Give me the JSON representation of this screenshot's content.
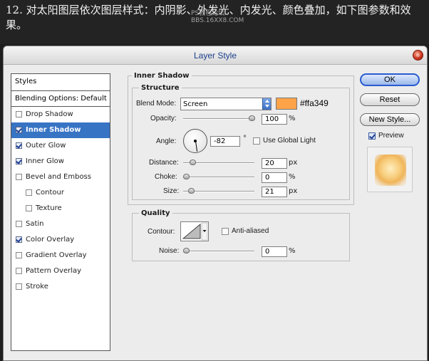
{
  "banner": {
    "text": "12. 对太阳图层依次图层样式：内阴影、外发光、内发光、颜色叠加，如下图参数和效果。",
    "watermark_line1": "PS教程论坛",
    "watermark_line2": "BBS.16XX8.COM"
  },
  "dialog": {
    "title": "Layer Style"
  },
  "styles_panel": {
    "header": "Styles",
    "blending_options": "Blending Options: Default",
    "items": [
      {
        "label": "Drop Shadow",
        "checked": false,
        "indent": 0,
        "selected": false
      },
      {
        "label": "Inner Shadow",
        "checked": true,
        "indent": 0,
        "selected": true
      },
      {
        "label": "Outer Glow",
        "checked": true,
        "indent": 0,
        "selected": false
      },
      {
        "label": "Inner Glow",
        "checked": true,
        "indent": 0,
        "selected": false
      },
      {
        "label": "Bevel and Emboss",
        "checked": false,
        "indent": 0,
        "selected": false
      },
      {
        "label": "Contour",
        "checked": false,
        "indent": 1,
        "selected": false
      },
      {
        "label": "Texture",
        "checked": false,
        "indent": 1,
        "selected": false
      },
      {
        "label": "Satin",
        "checked": false,
        "indent": 0,
        "selected": false
      },
      {
        "label": "Color Overlay",
        "checked": true,
        "indent": 0,
        "selected": false
      },
      {
        "label": "Gradient Overlay",
        "checked": false,
        "indent": 0,
        "selected": false
      },
      {
        "label": "Pattern Overlay",
        "checked": false,
        "indent": 0,
        "selected": false
      },
      {
        "label": "Stroke",
        "checked": false,
        "indent": 0,
        "selected": false
      }
    ]
  },
  "inner_shadow": {
    "section_title": "Inner Shadow",
    "structure_title": "Structure",
    "blend_mode_label": "Blend Mode:",
    "blend_mode_value": "Screen",
    "color_hex": "#ffa349",
    "color_swatch": "#ffa349",
    "opacity_label": "Opacity:",
    "opacity_value": "100",
    "opacity_unit": "%",
    "opacity_level": 1.0,
    "angle_label": "Angle:",
    "angle_value": "-82",
    "angle_unit": "°",
    "angle_degrees": -82,
    "use_global_light_label": "Use Global Light",
    "use_global_light": false,
    "distance_label": "Distance:",
    "distance_value": "20",
    "distance_unit": "px",
    "distance_level": 0.1,
    "choke_label": "Choke:",
    "choke_value": "0",
    "choke_unit": "%",
    "choke_level": 0.0,
    "size_label": "Size:",
    "size_value": "21",
    "size_unit": "px",
    "size_level": 0.08
  },
  "quality": {
    "title": "Quality",
    "contour_label": "Contour:",
    "anti_aliased_label": "Anti-aliased",
    "anti_aliased": false,
    "noise_label": "Noise:",
    "noise_value": "0",
    "noise_unit": "%",
    "noise_level": 0.0
  },
  "buttons": {
    "ok": "OK",
    "reset": "Reset",
    "new_style": "New Style...",
    "preview_label": "Preview",
    "preview_checked": true
  },
  "icons": {
    "close": "close-icon",
    "dropdown": "select-arrows-icon",
    "contour_menu": "chevron-down-icon"
  }
}
